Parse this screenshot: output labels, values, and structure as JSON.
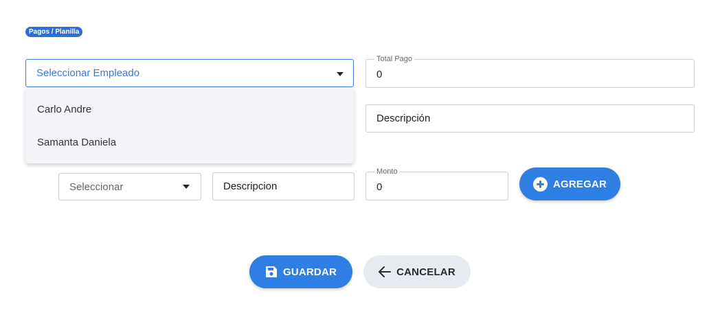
{
  "breadcrumb": "Pagos / Planilla",
  "employee_select": {
    "placeholder": "Seleccionar Empleado",
    "options": [
      "Carlo Andre",
      "Samanta Daniela"
    ]
  },
  "total_pago": {
    "label": "Total Pago",
    "value": "0"
  },
  "descripcion_main": {
    "placeholder": "Descripción"
  },
  "line_item": {
    "type_select": "Seleccionar",
    "descripcion": "Descripcion",
    "monto_label": "Monto",
    "monto_value": "0",
    "add_button": "AGREGAR"
  },
  "actions": {
    "save_label": "GUARDAR",
    "cancel_label": "CANCELAR"
  },
  "colors": {
    "primary": "#2f7ee4",
    "badge": "#2d6fd8",
    "secondary_bg": "#e6ebf1"
  },
  "icons": [
    "caret-down-icon",
    "plus-circle-icon",
    "save-icon",
    "arrow-left-icon"
  ]
}
